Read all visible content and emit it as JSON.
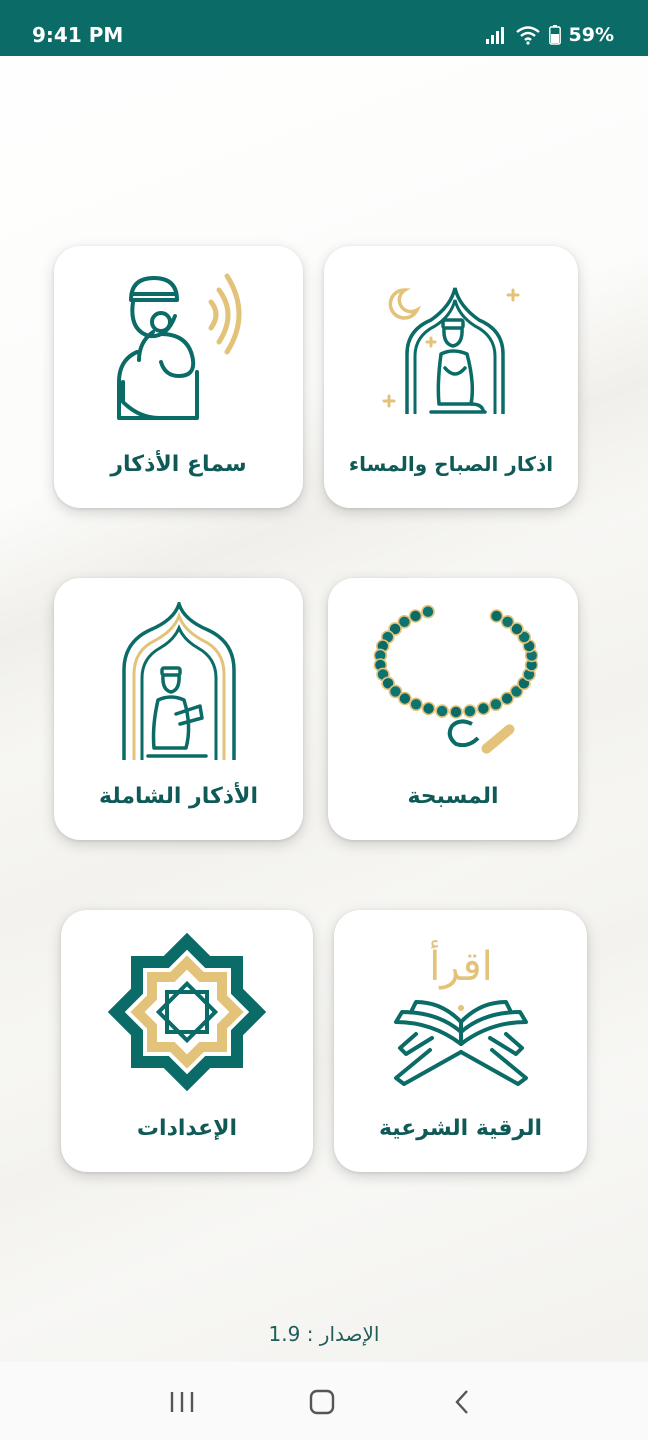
{
  "status_bar": {
    "time": "9:41 PM",
    "battery": "59%"
  },
  "menu": {
    "morning_evening": "اذكار الصباح والمساء",
    "listen_adhkar": "سماع الأذكار",
    "tasbih": "المسبحة",
    "complete_adhkar": "الأذكار الشاملة",
    "ruqyah": "الرقية الشرعية",
    "settings": "الإعدادات",
    "quran_word": "اقرأ"
  },
  "footer": {
    "version": "الإصدار : 1.9"
  },
  "colors": {
    "primary": "#0a6b67",
    "gold": "#e3c27a",
    "text": "#0f5a57"
  },
  "icons": {
    "status": [
      "signal-icon",
      "wifi-icon",
      "battery-icon"
    ],
    "nav": [
      "recent-apps-icon",
      "home-icon",
      "back-icon"
    ]
  }
}
